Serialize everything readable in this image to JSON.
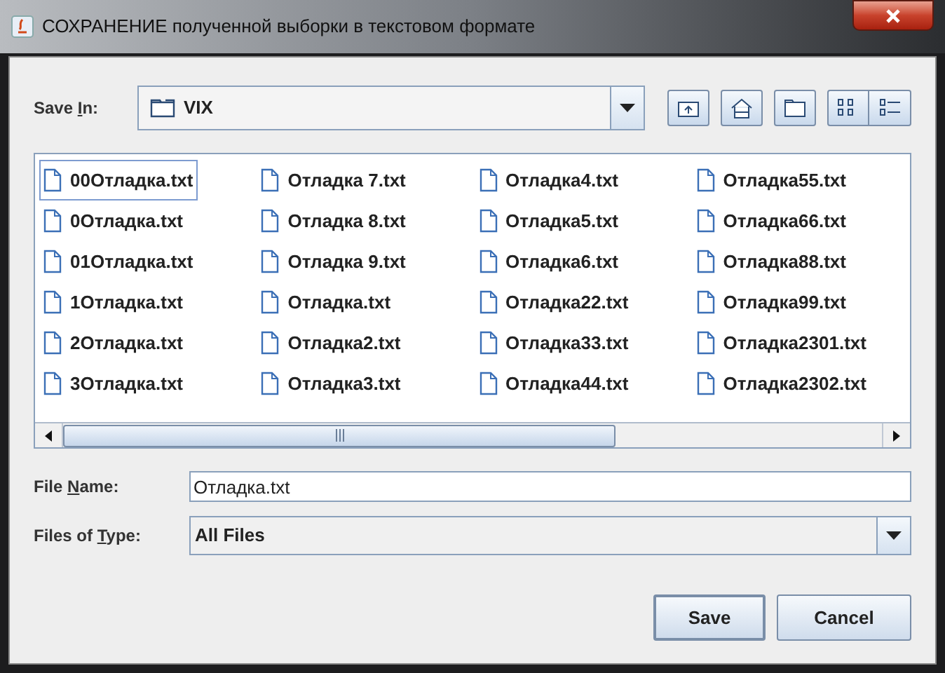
{
  "window": {
    "title": "СОХРАНЕНИЕ полученной выборки в текстовом формате"
  },
  "save_in": {
    "label_parts": [
      "Save ",
      "I",
      "n:"
    ],
    "value": "VIX"
  },
  "file_columns": [
    [
      {
        "name": "00Отладка.txt",
        "focused": true
      },
      {
        "name": "0Отладка.txt",
        "focused": false
      },
      {
        "name": "01Отладка.txt",
        "focused": false
      },
      {
        "name": "1Отладка.txt",
        "focused": false
      },
      {
        "name": "2Отладка.txt",
        "focused": false
      },
      {
        "name": "3Отладка.txt",
        "focused": false
      }
    ],
    [
      {
        "name": "Отладка 7.txt",
        "focused": false
      },
      {
        "name": "Отладка 8.txt",
        "focused": false
      },
      {
        "name": "Отладка 9.txt",
        "focused": false
      },
      {
        "name": "Отладка.txt",
        "focused": false
      },
      {
        "name": "Отладка2.txt",
        "focused": false
      },
      {
        "name": "Отладка3.txt",
        "focused": false
      }
    ],
    [
      {
        "name": "Отладка4.txt",
        "focused": false
      },
      {
        "name": "Отладка5.txt",
        "focused": false
      },
      {
        "name": "Отладка6.txt",
        "focused": false
      },
      {
        "name": "Отладка22.txt",
        "focused": false
      },
      {
        "name": "Отладка33.txt",
        "focused": false
      },
      {
        "name": "Отладка44.txt",
        "focused": false
      }
    ],
    [
      {
        "name": "Отладка55.txt",
        "focused": false
      },
      {
        "name": "Отладка66.txt",
        "focused": false
      },
      {
        "name": "Отладка88.txt",
        "focused": false
      },
      {
        "name": "Отладка99.txt",
        "focused": false
      },
      {
        "name": "Отладка2301.txt",
        "focused": false
      },
      {
        "name": "Отладка2302.txt",
        "focused": false
      }
    ]
  ],
  "file_name": {
    "label_parts": [
      "File ",
      "N",
      "ame:"
    ],
    "value": "Отладка.txt"
  },
  "file_type": {
    "label_parts": [
      "Files of ",
      "T",
      "ype:"
    ],
    "value": "All Files"
  },
  "buttons": [
    "Save",
    "Cancel"
  ]
}
